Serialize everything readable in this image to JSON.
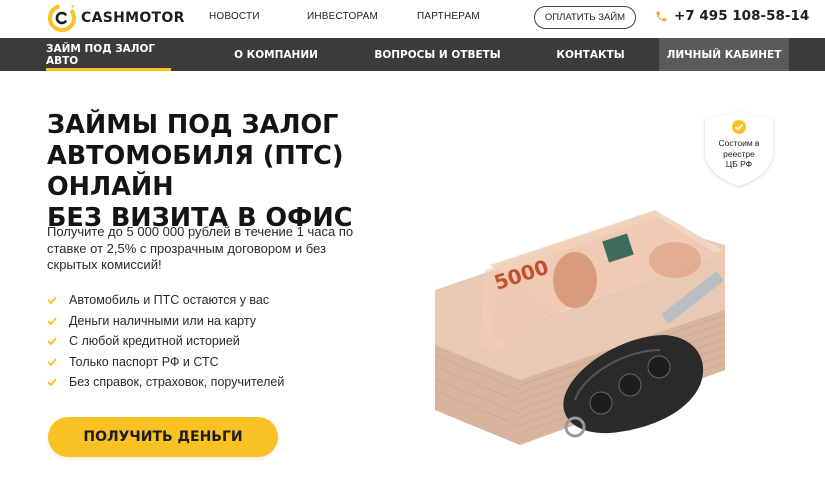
{
  "brand": {
    "name": "CASHMOTOR",
    "accent": "#f9c123",
    "dark": "#3b3b3b"
  },
  "top_links": [
    "НОВОСТИ",
    "ИНВЕСТОРАМ",
    "ПАРТНЕРАМ"
  ],
  "pay_button": "ОПЛАТИТЬ ЗАЙМ",
  "phone": "+7 495 108-58-14",
  "nav": [
    {
      "label": "ЗАЙМ ПОД ЗАЛОГ АВТО",
      "active": true
    },
    {
      "label": "О КОМПАНИИ",
      "active": false
    },
    {
      "label": "ВОПРОСЫ И ОТВЕТЫ",
      "active": false
    },
    {
      "label": "КОНТАКТЫ",
      "active": false
    },
    {
      "label": "ЛИЧНЫЙ КАБИНЕТ",
      "active": false
    }
  ],
  "hero": {
    "title_lines": [
      "ЗАЙМЫ ПОД ЗАЛОГ",
      "АВТОМОБИЛЯ (ПТС) ОНЛАЙН",
      "БЕЗ ВИЗИТА В ОФИС"
    ],
    "sub": {
      "p1": "Получите до ",
      "amount": "5 000 000 рублей",
      "p2": " в течение ",
      "time": "1 часа",
      "p3": " по ставке от ",
      "rate": "2,5%",
      "p4": " с прозрачным договором и без скрытых комиссий!"
    },
    "features": [
      "Автомобиль и ПТС остаются у вас",
      "Деньги наличными или на карту",
      "С любой кредитной историей",
      "Только паспорт РФ и СТС",
      "Без справок, страховок, поручителей"
    ],
    "cta": "ПОЛУЧИТЬ ДЕНЬГИ"
  },
  "badge": {
    "lines": [
      "Состоим в",
      "реестре",
      "ЦБ РФ"
    ]
  },
  "image": {
    "banknote_text": "5000",
    "icon": "money-and-car-key-image"
  }
}
